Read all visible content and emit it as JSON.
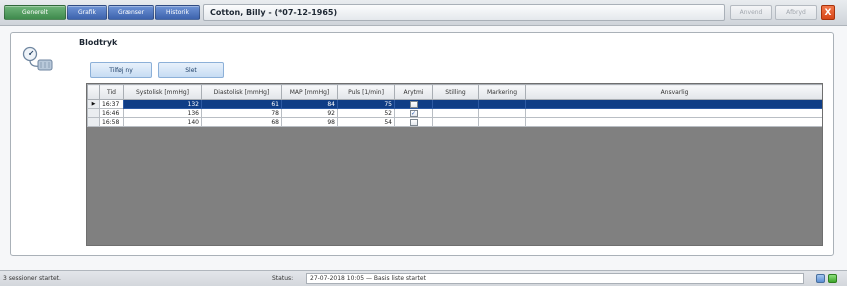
{
  "tabs": [
    {
      "label": "Generelt"
    },
    {
      "label": "Grafik"
    },
    {
      "label": "Grænser"
    },
    {
      "label": "Historik"
    }
  ],
  "patient": {
    "name": "Cotton, Billy - (*07-12-1965)"
  },
  "toolbar": {
    "apply_label": "Anvend",
    "cancel_label": "Afbryd",
    "close_label": "X"
  },
  "section": {
    "title": "Blodtryk",
    "add_label": "Tilføj ny",
    "delete_label": "Slet"
  },
  "table": {
    "columns": [
      "Tid",
      "Systolisk [mmHg]",
      "Diastolisk [mmHg]",
      "MAP [mmHg]",
      "Puls [1/min]",
      "Arytmi",
      "Stilling",
      "Markering",
      "Ansvarlig"
    ],
    "rows": [
      {
        "tid": "16:37",
        "systolisk": "132",
        "diastolisk": "61",
        "map": "84",
        "puls": "75",
        "arytmi": false,
        "stilling": "",
        "markering": "",
        "ansvarlig": "",
        "selected": true
      },
      {
        "tid": "16:46",
        "systolisk": "136",
        "diastolisk": "78",
        "map": "92",
        "puls": "52",
        "arytmi": true,
        "stilling": "",
        "markering": "",
        "ansvarlig": "",
        "selected": false
      },
      {
        "tid": "16:58",
        "systolisk": "140",
        "diastolisk": "68",
        "map": "98",
        "puls": "54",
        "arytmi": false,
        "stilling": "",
        "markering": "",
        "ansvarlig": "",
        "selected": false
      }
    ],
    "selection_indicator": "▶"
  },
  "statusbar": {
    "left_text": "3 sessioner startet.",
    "status_label": "Status:",
    "status_value": "27-07-2018 10:05 — Basis liste startet"
  },
  "colors": {
    "tab_active": "#3f8a4d",
    "tab_inactive": "#3d63ad",
    "selection": "#0f3d86",
    "close_button": "#d64618",
    "grid_background": "#808080"
  },
  "icons": {
    "section_icon": "blood-pressure-cuff-icon",
    "close": "close-icon",
    "checkbox": "checkbox-icon"
  }
}
